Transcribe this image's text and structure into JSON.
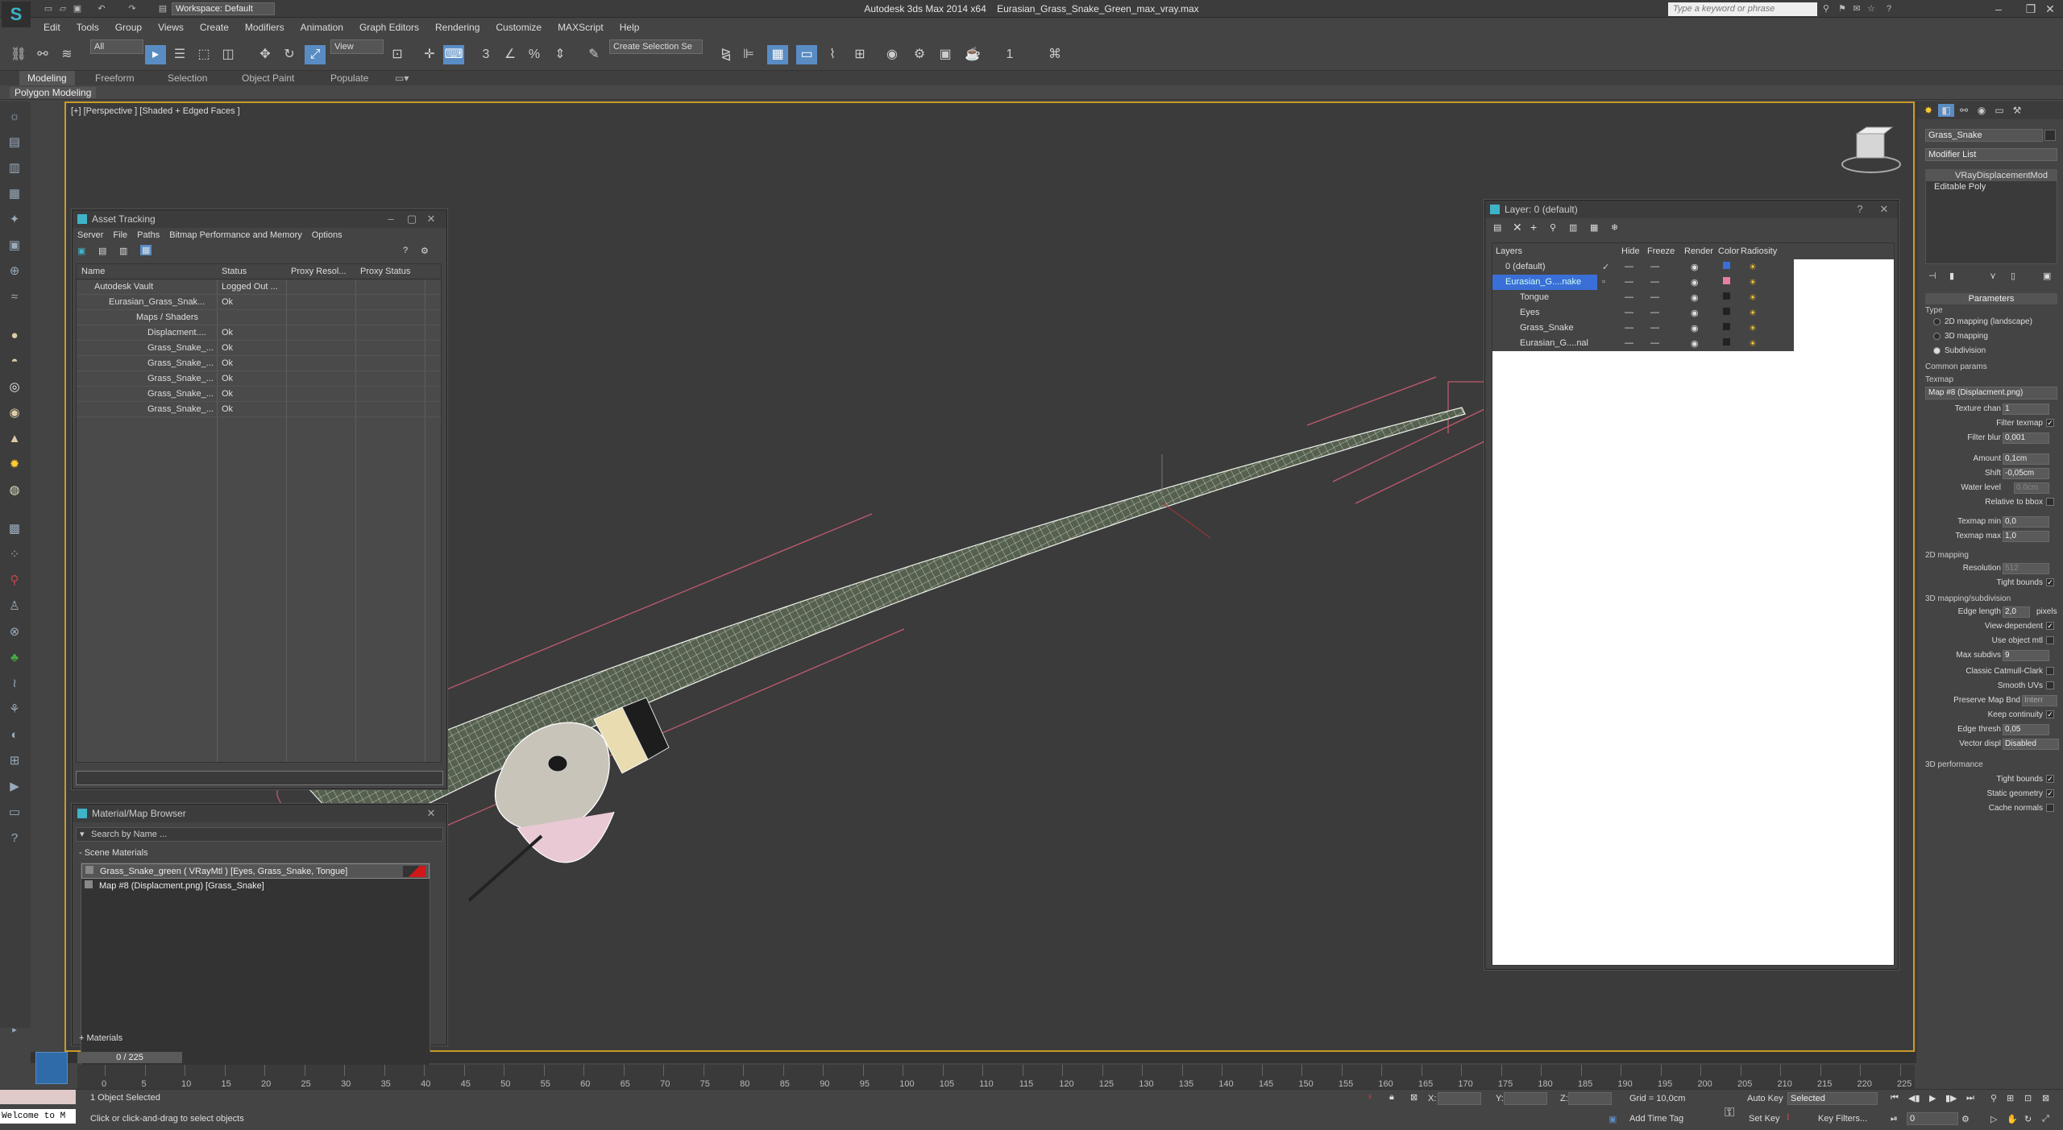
{
  "title": {
    "app": "Autodesk 3ds Max  2014 x64",
    "file": "Eurasian_Grass_Snake_Green_max_vray.max",
    "workspace": "Workspace: Default",
    "search_placeholder": "Type a keyword or phrase"
  },
  "menu": [
    "Edit",
    "Tools",
    "Group",
    "Views",
    "Create",
    "Modifiers",
    "Animation",
    "Graph Editors",
    "Rendering",
    "Customize",
    "MAXScript",
    "Help"
  ],
  "toolbar": {
    "filter": "All",
    "refcoord": "View",
    "named_selection": "Create Selection Se",
    "counter": "1"
  },
  "ribbon": {
    "tabs": [
      "Modeling",
      "Freeform",
      "Selection",
      "Object Paint",
      "Populate"
    ],
    "sub": "Polygon Modeling"
  },
  "viewport": {
    "label": "[+] [Perspective ] [Shaded + Edged Faces ]"
  },
  "asset_tracking": {
    "title": "Asset Tracking",
    "menu": [
      "Server",
      "File",
      "Paths",
      "Bitmap Performance and Memory",
      "Options"
    ],
    "columns": [
      "Name",
      "Status",
      "Proxy Resol...",
      "Proxy Status"
    ],
    "rows": [
      {
        "name": "Autodesk Vault",
        "status": "Logged Out ..."
      },
      {
        "name": "Eurasian_Grass_Snak...",
        "status": "Ok"
      },
      {
        "name": "Maps / Shaders",
        "status": ""
      },
      {
        "name": "Displacment....",
        "status": "Ok"
      },
      {
        "name": "Grass_Snake_...",
        "status": "Ok"
      },
      {
        "name": "Grass_Snake_...",
        "status": "Ok"
      },
      {
        "name": "Grass_Snake_...",
        "status": "Ok"
      },
      {
        "name": "Grass_Snake_...",
        "status": "Ok"
      },
      {
        "name": "Grass_Snake_...",
        "status": "Ok"
      }
    ]
  },
  "material_browser": {
    "title": "Material/Map Browser",
    "search": "Search by Name ...",
    "group": "- Scene Materials",
    "items": [
      "Grass_Snake_green  ( VRayMtl ) [Eyes, Grass_Snake, Tongue]",
      "Map #8 (Displacment.png)  [Grass_Snake]"
    ],
    "footer": "+ Materials"
  },
  "layer_dialog": {
    "title": "Layer: 0 (default)",
    "columns": [
      "Layers",
      "Hide",
      "Freeze",
      "Render",
      "Color",
      "Radiosity"
    ],
    "rows": [
      {
        "name": "0 (default)",
        "color": "#3a6fd8"
      },
      {
        "name": "Eurasian_G....nake",
        "color": "#e87ea0"
      },
      {
        "name": "Tongue",
        "color": "#222222"
      },
      {
        "name": "Eyes",
        "color": "#222222"
      },
      {
        "name": "Grass_Snake",
        "color": "#222222"
      },
      {
        "name": "Eurasian_G....nal",
        "color": "#222222"
      }
    ]
  },
  "command_panel": {
    "object_name": "Grass_Snake",
    "modifier_list": "Modifier List",
    "stack": [
      "VRayDisplacementMod",
      "Editable Poly"
    ],
    "parameters_title": "Parameters",
    "type_label": "Type",
    "type_options": [
      "2D mapping (landscape)",
      "3D mapping",
      "Subdivision"
    ],
    "common_params": "Common params",
    "texmap_label": "Texmap",
    "texmap_value": "Map #8 (Displacment.png)",
    "texture_chan_label": "Texture chan",
    "texture_chan": "1",
    "filter_texmap": "Filter texmap",
    "filter_blur_label": "Filter blur",
    "filter_blur": "0,001",
    "amount_label": "Amount",
    "amount": "0,1cm",
    "shift_label": "Shift",
    "shift": "-0,05cm",
    "water_level_label": "Water level",
    "water_level": "0,0cm",
    "relative_bbox": "Relative to bbox",
    "texmap_min_label": "Texmap min",
    "texmap_min": "0,0",
    "texmap_max_label": "Texmap max",
    "texmap_max": "1,0",
    "mapping2d": "2D mapping",
    "resolution_label": "Resolution",
    "resolution": "512",
    "tight_bounds": "Tight bounds",
    "mapping3d": "3D mapping/subdivision",
    "edge_length_label": "Edge length",
    "edge_length": "2,0",
    "pixels": "pixels",
    "view_dependent": "View-dependent",
    "use_object_mtl": "Use object mtl",
    "max_subdivs_label": "Max subdivs",
    "max_subdivs": "9",
    "classic_catmull": "Classic Catmull-Clark",
    "smooth_uvs": "Smooth UVs",
    "preserve_map_bnd": "Preserve Map Bnd",
    "preserve_value": "Interr",
    "keep_continuity": "Keep continuity",
    "edge_thresh_label": "Edge thresh",
    "edge_thresh": "0,05",
    "vector_disp_label": "Vector displ",
    "vector_disp": "Disabled",
    "perf": "3D performance",
    "perf_tight": "Tight bounds",
    "static_geometry": "Static geometry",
    "cache_normals": "Cache normals"
  },
  "timeline": {
    "slider": "0 / 225",
    "ticks": [
      "0",
      "5",
      "10",
      "15",
      "20",
      "25",
      "30",
      "35",
      "40",
      "45",
      "50",
      "55",
      "60",
      "65",
      "70",
      "75",
      "80",
      "85",
      "90",
      "95",
      "100",
      "105",
      "110",
      "115",
      "120",
      "125",
      "130",
      "135",
      "140",
      "145",
      "150",
      "155",
      "160",
      "165",
      "170",
      "175",
      "180",
      "185",
      "190",
      "195",
      "200",
      "205",
      "210",
      "215",
      "220",
      "225"
    ]
  },
  "status": {
    "welcome": "Welcome to M",
    "selected": "1 Object Selected",
    "hint": "Click or click-and-drag to select objects",
    "x": "X:",
    "y": "Y:",
    "z": "Z:",
    "grid": "Grid = 10,0cm",
    "add_time_tag": "Add Time Tag",
    "auto_key": "Auto Key",
    "set_key": "Set Key",
    "selected_option": "Selected",
    "key_filters": "Key Filters...",
    "frame": "0"
  }
}
